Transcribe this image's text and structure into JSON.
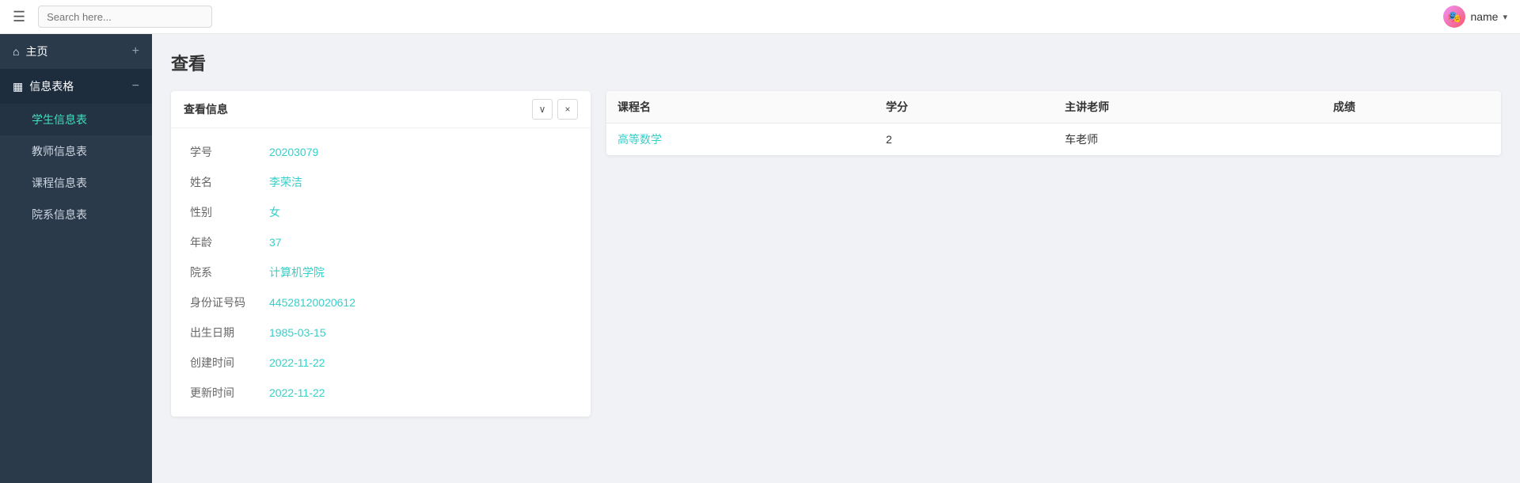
{
  "navbar": {
    "search_placeholder": "Search here...",
    "user_name": "name",
    "menu_icon": "☰",
    "chevron": "▾"
  },
  "sidebar": {
    "home_label": "主页",
    "home_icon": "⌂",
    "group_label": "信息表格",
    "group_icon": "▦",
    "sub_items": [
      {
        "label": "学生信息表",
        "active": true
      },
      {
        "label": "教师信息表",
        "active": false
      },
      {
        "label": "课程信息表",
        "active": false
      },
      {
        "label": "院系信息表",
        "active": false
      }
    ],
    "plus_icon": "+",
    "minus_icon": "−"
  },
  "page": {
    "title": "查看"
  },
  "info_card": {
    "header": "查看信息",
    "collapse_icon": "∨",
    "close_icon": "×",
    "fields": [
      {
        "label": "学号",
        "value": "20203079"
      },
      {
        "label": "姓名",
        "value": "李荣洁"
      },
      {
        "label": "性别",
        "value": "女"
      },
      {
        "label": "年龄",
        "value": "37"
      },
      {
        "label": "院系",
        "value": "计算机学院"
      },
      {
        "label": "身份证号码",
        "value": "44528120020612"
      },
      {
        "label": "出生日期",
        "value": "1985-03-15"
      },
      {
        "label": "创建时间",
        "value": "2022-11-22"
      },
      {
        "label": "更新时间",
        "value": "2022-11-22"
      }
    ]
  },
  "course_table": {
    "columns": [
      "课程名",
      "学分",
      "主讲老师",
      "成绩"
    ],
    "rows": [
      {
        "course_name": "高等数学",
        "credit": "2",
        "teacher": "车老师",
        "score": ""
      }
    ]
  }
}
